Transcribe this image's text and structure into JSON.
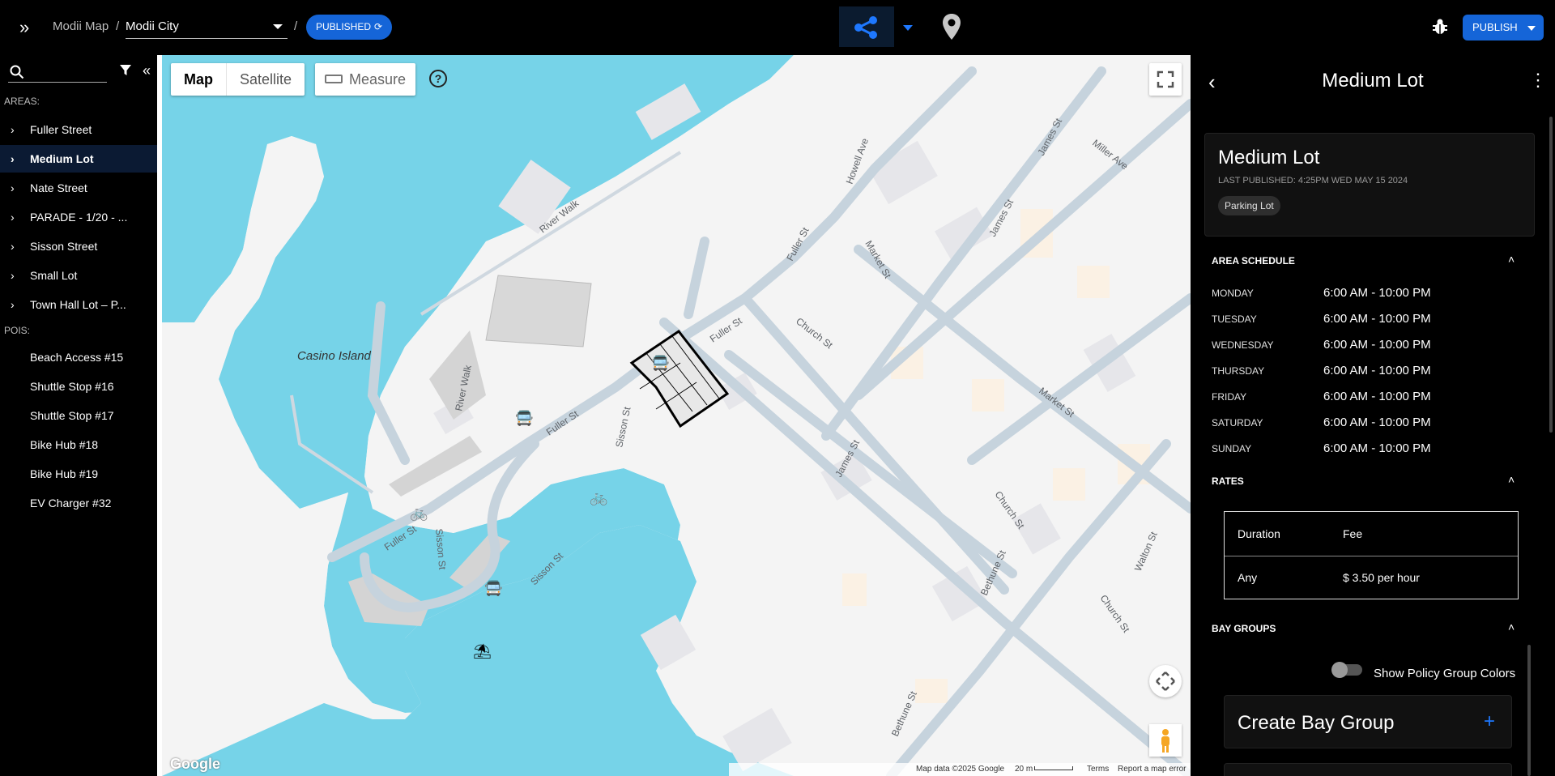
{
  "header": {
    "breadcrumb_root": "Modii Map",
    "separator": "/",
    "city": "Modii City",
    "status": "PUBLISHED",
    "publish_label": "PUBLISH",
    "accent": "#1565d8"
  },
  "sidebar": {
    "search_placeholder": "",
    "areas_label": "AREAS:",
    "areas": [
      {
        "label": "Fuller Street",
        "active": false
      },
      {
        "label": "Medium Lot",
        "active": true
      },
      {
        "label": "Nate Street",
        "active": false
      },
      {
        "label": "PARADE - 1/20 - ...",
        "active": false
      },
      {
        "label": "Sisson Street",
        "active": false
      },
      {
        "label": "Small Lot",
        "active": false
      },
      {
        "label": "Town Hall Lot – P...",
        "active": false
      }
    ],
    "pois_label": "POIS:",
    "pois": [
      "Beach Access #15",
      "Shuttle Stop #16",
      "Shuttle Stop #17",
      "Bike Hub #18",
      "Bike Hub #19",
      "EV Charger #32"
    ]
  },
  "map": {
    "type_options": [
      "Map",
      "Satellite"
    ],
    "selected_type": "Map",
    "measure_label": "Measure",
    "labels": {
      "casino_island": "Casino Island",
      "river_walk_1": "River Walk",
      "river_walk_2": "River Walk",
      "fuller_st_1": "Fuller St",
      "fuller_st_2": "Fuller St",
      "fuller_st_3": "Fuller St",
      "fuller_st_4": "Fuller St",
      "sisson_st_1": "Sisson St",
      "sisson_st_2": "Sisson St",
      "sisson_st_3": "Sisson St",
      "howell_ave": "Howell Ave",
      "market_st_1": "Market St",
      "market_st_2": "Market St",
      "church_st_1": "Church St",
      "church_st_2": "Church St",
      "church_st_3": "Church St",
      "james_st_1": "James St",
      "james_st_2": "James St",
      "james_st_3": "James St",
      "miller_ave": "Miller Ave",
      "bethune_st_1": "Bethune St",
      "bethune_st_2": "Bethune St",
      "walton_st": "Walton St"
    },
    "google": "Google",
    "attribution": {
      "data": "Map data ©2025 Google",
      "scale": "20 m",
      "terms": "Terms",
      "report": "Report a map error"
    },
    "water_color": "#76d3e8"
  },
  "panel": {
    "title": "Medium Lot",
    "card_title": "Medium Lot",
    "last_published": "LAST PUBLISHED: 4:25PM WED MAY 15 2024",
    "chip": "Parking Lot",
    "schedule_heading": "AREA SCHEDULE",
    "schedule": [
      {
        "day": "MONDAY",
        "hours": "6:00 AM - 10:00 PM"
      },
      {
        "day": "TUESDAY",
        "hours": "6:00 AM - 10:00 PM"
      },
      {
        "day": "WEDNESDAY",
        "hours": "6:00 AM - 10:00 PM"
      },
      {
        "day": "THURSDAY",
        "hours": "6:00 AM - 10:00 PM"
      },
      {
        "day": "FRIDAY",
        "hours": "6:00 AM - 10:00 PM"
      },
      {
        "day": "SATURDAY",
        "hours": "6:00 AM - 10:00 PM"
      },
      {
        "day": "SUNDAY",
        "hours": "6:00 AM - 10:00 PM"
      }
    ],
    "rates_heading": "RATES",
    "rates_columns": [
      "Duration",
      "Fee"
    ],
    "rates_rows": [
      [
        "Any",
        "$ 3.50 per hour"
      ]
    ],
    "bay_groups_heading": "BAY GROUPS",
    "toggle_label": "Show Policy Group Colors",
    "toggle_on": false,
    "create_label": "Create Bay Group"
  }
}
